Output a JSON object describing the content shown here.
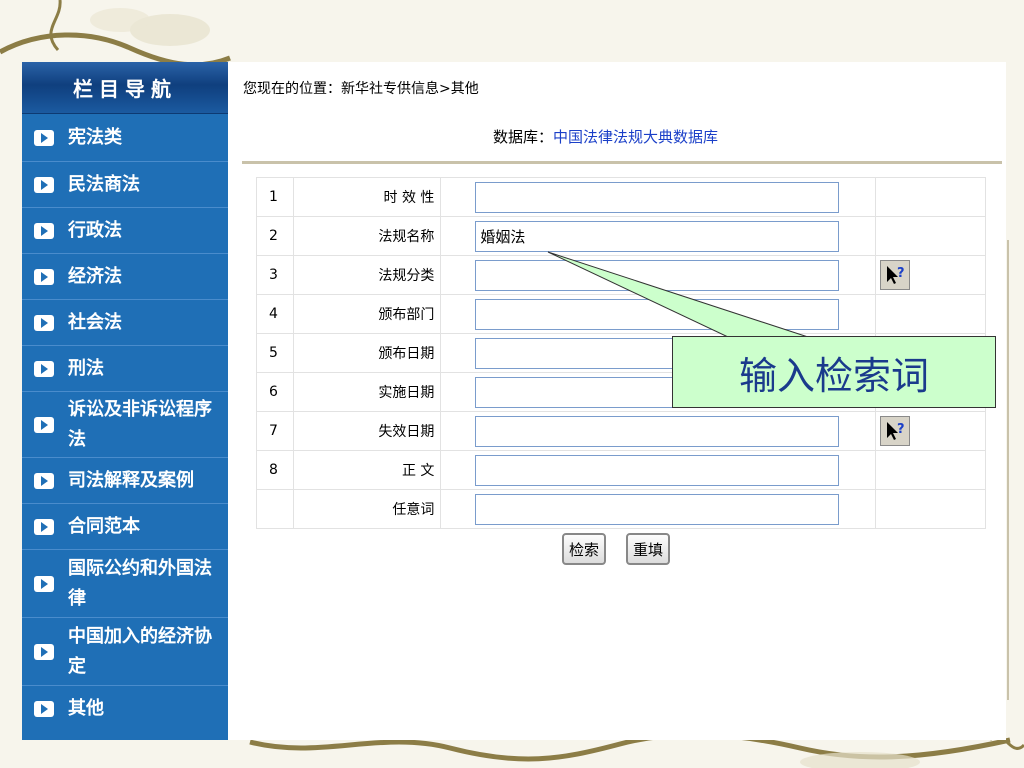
{
  "sidebar": {
    "title": "栏目导航",
    "items": [
      {
        "label": "宪法类"
      },
      {
        "label": "民法商法"
      },
      {
        "label": "行政法"
      },
      {
        "label": "经济法"
      },
      {
        "label": "社会法"
      },
      {
        "label": "刑法"
      },
      {
        "label": "诉讼及非诉讼程序法"
      },
      {
        "label": "司法解释及案例"
      },
      {
        "label": "合同范本"
      },
      {
        "label": "国际公约和外国法律"
      },
      {
        "label": "中国加入的经济协定"
      },
      {
        "label": "其他"
      }
    ]
  },
  "breadcrumb": "您现在的位置：新华社专供信息>其他",
  "database": {
    "prefix": "数据库：",
    "name": "中国法律法规大典数据库"
  },
  "form": {
    "rows": [
      {
        "num": "1",
        "label": "时 效 性",
        "value": "",
        "help": false
      },
      {
        "num": "2",
        "label": "法规名称",
        "value": "婚姻法",
        "help": false
      },
      {
        "num": "3",
        "label": "法规分类",
        "value": "",
        "help": true
      },
      {
        "num": "4",
        "label": "颁布部门",
        "value": "",
        "help": false
      },
      {
        "num": "5",
        "label": "颁布日期",
        "value": "",
        "help": false
      },
      {
        "num": "6",
        "label": "实施日期",
        "value": "",
        "help": false
      },
      {
        "num": "7",
        "label": "失效日期",
        "value": "",
        "help": true
      },
      {
        "num": "8",
        "label": "正 文",
        "value": "",
        "help": false
      },
      {
        "num": "",
        "label": "任意词",
        "value": "",
        "help": false
      }
    ],
    "search_label": "检索",
    "reset_label": "重填"
  },
  "callout": {
    "text": "输入检索词"
  },
  "colors": {
    "sidebar": "#1f6fb6",
    "callout_fill": "#ccffcc",
    "callout_text": "#1a3a8c",
    "db_name": "#1a3fc8"
  }
}
